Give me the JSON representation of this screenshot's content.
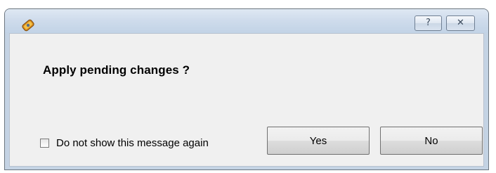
{
  "dialog": {
    "icon": "app-gem-icon",
    "caption_buttons": {
      "help_glyph": "?",
      "close_glyph": "✕"
    },
    "message": "Apply pending changes ?",
    "checkbox": {
      "label": "Do not show this message again",
      "checked": false
    },
    "buttons": {
      "yes_label": "Yes",
      "no_label": "No"
    }
  }
}
